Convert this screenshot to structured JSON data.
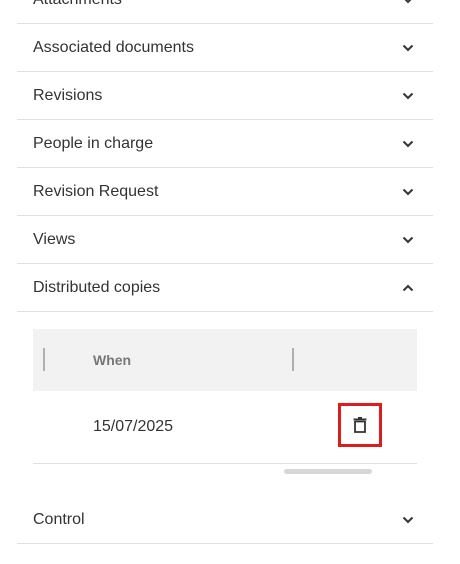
{
  "sections": [
    {
      "label": "Attachments",
      "expanded": false,
      "icon": "chevron-down-icon"
    },
    {
      "label": "Associated documents",
      "expanded": false,
      "icon": "chevron-down-icon"
    },
    {
      "label": "Revisions",
      "expanded": false,
      "icon": "chevron-down-icon"
    },
    {
      "label": "People in charge",
      "expanded": false,
      "icon": "chevron-down-icon"
    },
    {
      "label": "Revision Request",
      "expanded": false,
      "icon": "chevron-down-icon"
    },
    {
      "label": "Views",
      "expanded": false,
      "icon": "chevron-down-icon"
    },
    {
      "label": "Distributed copies",
      "expanded": true,
      "icon": "chevron-up-icon"
    },
    {
      "label": "Control",
      "expanded": false,
      "icon": "chevron-down-icon"
    }
  ],
  "distributed_copies": {
    "columns": [
      "When"
    ],
    "rows": [
      {
        "when": "15/07/2025",
        "action_icon": "trash-icon"
      }
    ]
  },
  "colors": {
    "highlight": "#e01b1b",
    "header_bg": "#f2f2f2",
    "divider": "#e0e0e0",
    "text": "#333333"
  }
}
